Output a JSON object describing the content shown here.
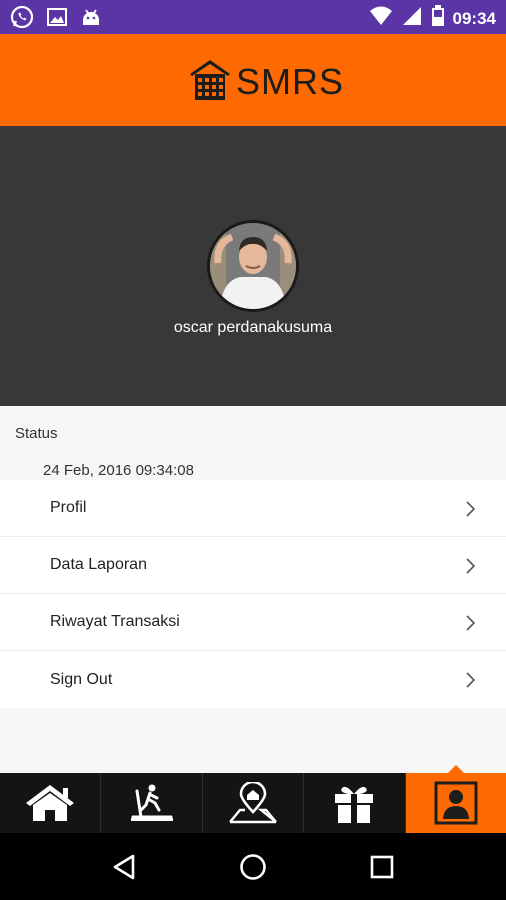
{
  "status_bar": {
    "time": "09:34",
    "left_icons": [
      "whatsapp-icon",
      "image-icon",
      "android-icon"
    ],
    "right_icons": [
      "wifi-icon",
      "signal-icon",
      "battery-icon"
    ],
    "background": "#5b34a6"
  },
  "header": {
    "logo_text": "SMRS",
    "background": "#ff6a00"
  },
  "profile": {
    "name": "oscar perdanakusuma"
  },
  "status": {
    "label": "Status",
    "timestamp": "24 Feb, 2016 09:34:08"
  },
  "menu": {
    "items": [
      {
        "label": "Profil"
      },
      {
        "label": "Data Laporan"
      },
      {
        "label": "Riwayat Transaksi"
      },
      {
        "label": "Sign Out"
      }
    ]
  },
  "bottom_nav": {
    "tabs": [
      {
        "icon": "home-icon",
        "active": false
      },
      {
        "icon": "treadmill-icon",
        "active": false
      },
      {
        "icon": "location-map-icon",
        "active": false
      },
      {
        "icon": "gift-icon",
        "active": false
      },
      {
        "icon": "profile-icon",
        "active": true
      }
    ],
    "active_color": "#ff6a00"
  },
  "system_nav": {
    "buttons": [
      "back-icon",
      "home-circle-icon",
      "recents-icon"
    ]
  }
}
